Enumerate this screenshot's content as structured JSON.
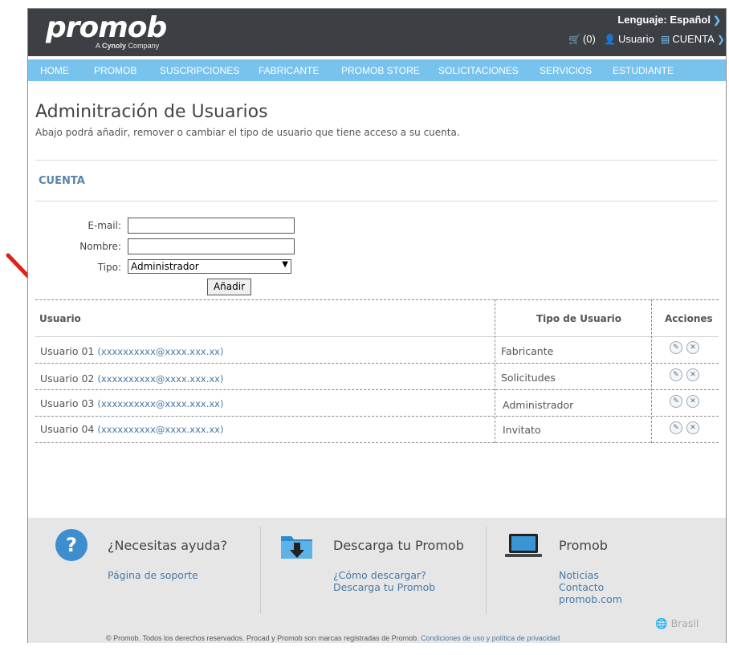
{
  "header": {
    "logo": "promob",
    "logo_sub_prefix": "A",
    "logo_sub_brand": "Cynoly",
    "logo_sub_suffix": "Company",
    "language": "Lenguaje: Español",
    "cart": "(0)",
    "user": "Usuario",
    "account": "CUENTA"
  },
  "nav": {
    "items": [
      "HOME",
      "PROMOB",
      "SUSCRIPCIONES",
      "FABRICANTE",
      "PROMOB STORE",
      "SOLICITACIONES",
      "SERVICIOS",
      "ESTUDIANTE"
    ]
  },
  "page": {
    "title": "Adminitración de Usuarios",
    "description": "Abajo podrá añadir, remover o cambiar el tipo de usuario que tiene acceso a su cuenta.",
    "section_title": "CUENTA"
  },
  "form": {
    "email_label": "E-mail:",
    "email_value": "",
    "name_label": "Nombre:",
    "name_value": "",
    "type_label": "Tipo:",
    "type_selected": "Administrador",
    "add_button": "Añadir"
  },
  "table": {
    "headers": {
      "user": "Usuario",
      "type": "Tipo de Usuario",
      "actions": "Acciones"
    },
    "rows": [
      {
        "name": "Usuario 01",
        "email": "(xxxxxxxxxx@xxxx.xxx.xx)",
        "type": "Fabricante"
      },
      {
        "name": "Usuario 02",
        "email": "(xxxxxxxxxx@xxxx.xxx.xx)",
        "type": "Solicitudes"
      },
      {
        "name": "Usuario 03",
        "email": "(xxxxxxxxxx@xxxx.xxx.xx)",
        "type": "Administrador"
      },
      {
        "name": "Usuario 04",
        "email": "(xxxxxxxxxx@xxxx.xxx.xx)",
        "type": "Invitato"
      }
    ]
  },
  "footer": {
    "help_title": "¿Necesitas ayuda?",
    "help_link": "Página de soporte",
    "download_title": "Descarga tu Promob",
    "download_link_1": "¿Cómo descargar?",
    "download_link_2": "Descarga tu Promob",
    "promob_title": "Promob",
    "promob_link_1": "Noticias",
    "promob_link_2": "Contacto",
    "promob_link_3": "promob.com",
    "region": "Brasil",
    "copyright": "© Promob. Todos los derechos reservados. Procad y Promob son marcas registradas de Promob.",
    "terms_link": "Condiciones de uso y política de privacidad"
  },
  "colors": {
    "topbar": "#3c3f44",
    "navbar": "#78c3ee",
    "link": "#4a79a4",
    "section": "#5b85aa",
    "annotation_arrow": "#e0201b"
  }
}
